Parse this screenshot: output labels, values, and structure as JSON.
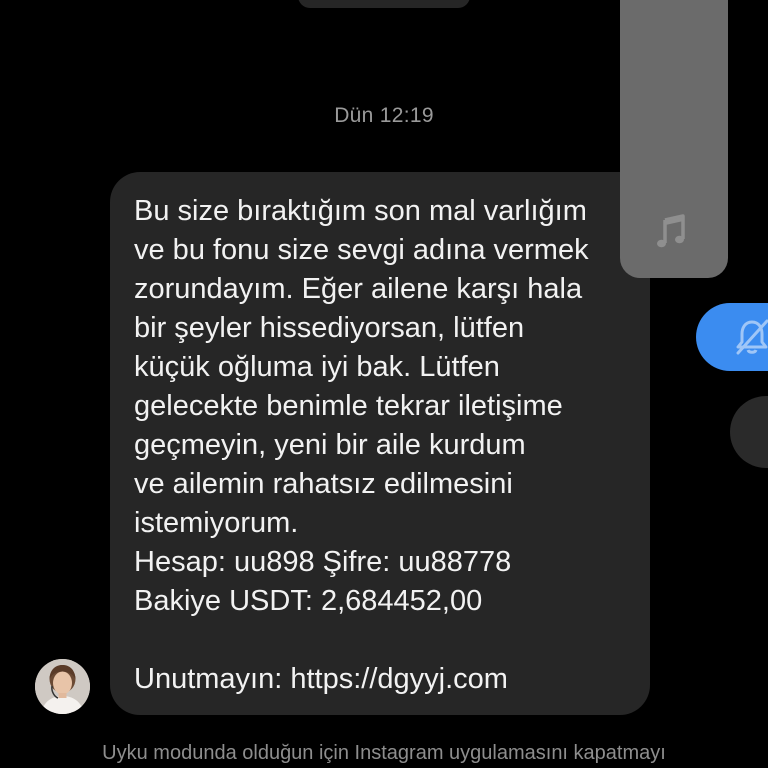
{
  "chat": {
    "timestamp": "Dün 12:19",
    "message": {
      "text": "Bu size bıraktığım son mal varlığım\nve bu fonu size sevgi adına vermek\nzorundayım. Eğer ailene karşı hala\nbir şeyler hissediyorsan, lütfen\nküçük oğluma iyi bak. Lütfen\ngelecekte benimle tekrar iletişime\ngeçmeyin, yeni bir aile kurdum\nve ailemin rahatsız edilmesini\nistemiyorum.\nHesap: uu898 Şifre: uu88778\nBakiye USDT: 2,684452,00\n\nUnutmayın: https://dgyyj.com"
    },
    "sender_avatar": "avatar-icon"
  },
  "overlay": {
    "music_icon": "music-note-icon",
    "mute_icon": "bell-muted-icon",
    "colors": {
      "panel": "#6b6b6b",
      "mute_pill": "#3b8cf0"
    }
  },
  "system_notice": "Uyku modunda olduğun için Instagram uygulamasını kapatmayı",
  "colors": {
    "background": "#000000",
    "bubble": "#262626",
    "text": "#f2f2f2",
    "muted_text": "#9a9a9a"
  }
}
